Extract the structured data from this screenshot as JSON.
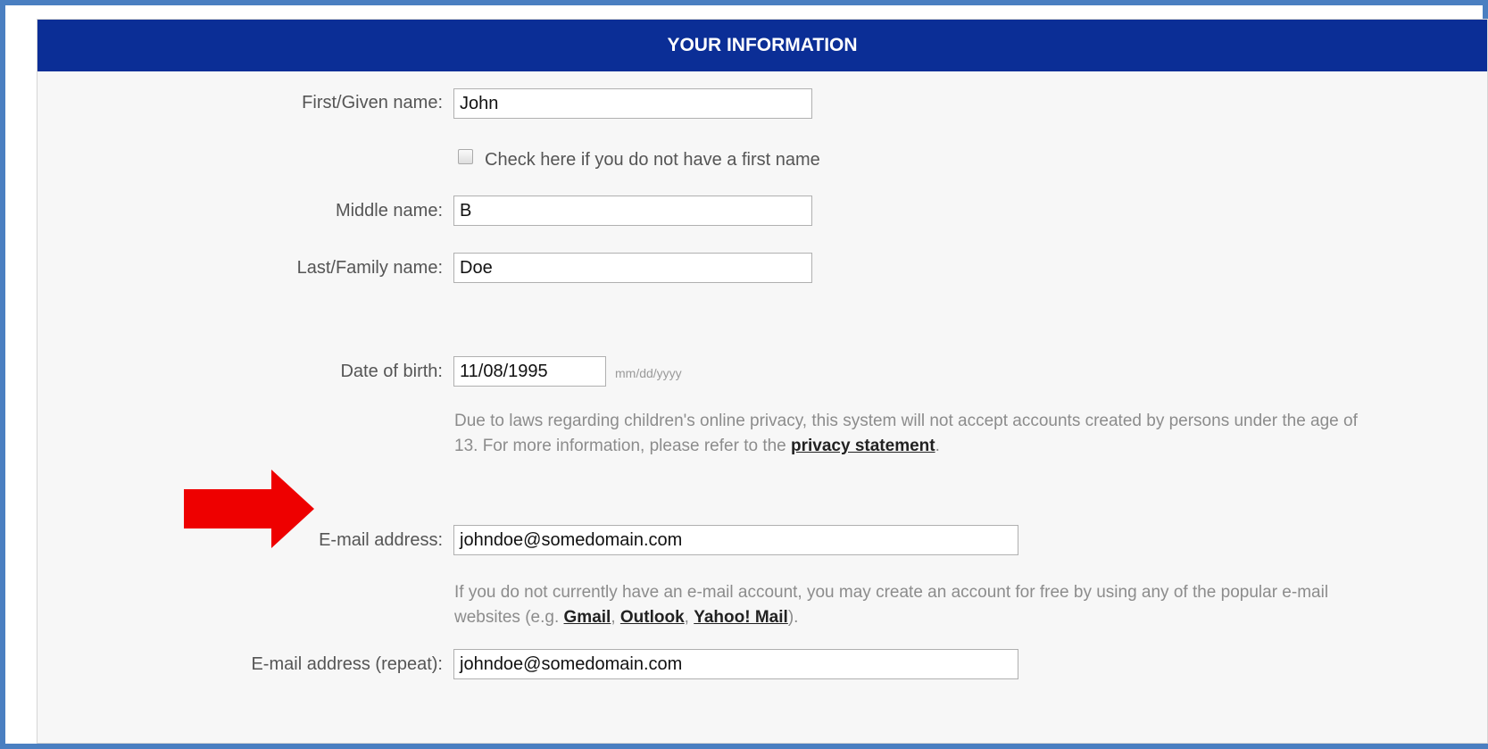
{
  "section": {
    "title": "YOUR INFORMATION"
  },
  "fields": {
    "first_name": {
      "label": "First/Given name:",
      "value": "John"
    },
    "no_first_name_checkbox": {
      "label": "Check here if you do not have a first name",
      "checked": false
    },
    "middle_name": {
      "label": "Middle name:",
      "value": "B"
    },
    "last_name": {
      "label": "Last/Family name:",
      "value": "Doe"
    },
    "dob": {
      "label": "Date of birth:",
      "value": "11/08/1995",
      "format_hint": "mm/dd/yyyy"
    },
    "email": {
      "label": "E-mail address:",
      "value": "johndoe@somedomain.com"
    },
    "email_repeat": {
      "label": "E-mail address (repeat):",
      "value": "johndoe@somedomain.com"
    }
  },
  "notes": {
    "privacy_text": "Due to laws regarding children's online privacy, this system will not accept accounts created by persons under the age of 13. For more information, please refer to the",
    "privacy_link": "privacy statement",
    "privacy_end": ".",
    "email_text": "If you do not currently have an e-mail account, you may create an account for free by using any of the popular e-mail websites (e.g.",
    "email_links": [
      "Gmail",
      "Outlook",
      "Yahoo! Mail"
    ],
    "email_sep": ", ",
    "email_end": ")."
  },
  "annotation": {
    "arrow_color": "#ee0000",
    "arrow_icon": "arrow-right-icon"
  },
  "colors": {
    "header_bg": "#0b2e96",
    "frame_border": "#4a7fc1"
  }
}
